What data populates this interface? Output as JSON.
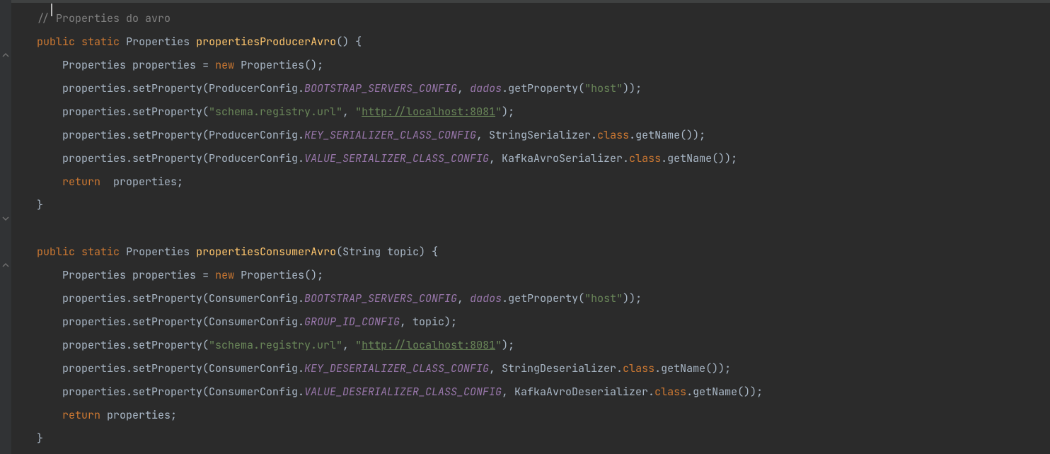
{
  "code": {
    "comment": "// Properties do avro",
    "method1": {
      "modifiers": [
        "public",
        "static"
      ],
      "returnType": "Properties",
      "name": "propertiesProducerAvro",
      "params": "()",
      "body": {
        "decl_type": "Properties",
        "decl_var": "properties",
        "equals": "=",
        "new_kw": "new",
        "ctor": "Properties()",
        "line1_pre": "properties.setProperty(ProducerConfig.",
        "line1_const": "BOOTSTRAP_SERVERS_CONFIG",
        "line1_comma": ", ",
        "line1_dados": "dados",
        "line1_tail": ".getProperty(",
        "line1_str": "\"host\"",
        "line1_close": "));",
        "line2_pre": "properties.setProperty(",
        "line2_str1": "\"schema.registry.url\"",
        "line2_comma": ", ",
        "line2_q1": "\"",
        "line2_url": "http://localhost:8081",
        "line2_q2": "\"",
        "line2_close": ");",
        "line3_pre": "properties.setProperty(ProducerConfig.",
        "line3_const": "KEY_SERIALIZER_CLASS_CONFIG",
        "line3_mid": ", StringSerializer.",
        "line3_class": "class",
        "line3_tail": ".getName());",
        "line4_pre": "properties.setProperty(ProducerConfig.",
        "line4_const": "VALUE_SERIALIZER_CLASS_CONFIG",
        "line4_mid": ", KafkaAvroSerializer.",
        "line4_class": "class",
        "line4_tail": ".getName());",
        "return_kw": "return",
        "return_val": "  properties;"
      }
    },
    "method2": {
      "modifiers": [
        "public",
        "static"
      ],
      "returnType": "Properties",
      "name": "propertiesConsumerAvro",
      "params": "(String topic)",
      "body": {
        "decl_type": "Properties",
        "decl_var": "properties",
        "equals": "=",
        "new_kw": "new",
        "ctor": "Properties()",
        "line1_pre": "properties.setProperty(ConsumerConfig.",
        "line1_const": "BOOTSTRAP_SERVERS_CONFIG",
        "line1_comma": ", ",
        "line1_dados": "dados",
        "line1_tail": ".getProperty(",
        "line1_str": "\"host\"",
        "line1_close": "));",
        "line2_pre": "properties.setProperty(ConsumerConfig.",
        "line2_const": "GROUP_ID_CONFIG",
        "line2_tail": ", topic);",
        "line3_pre": "properties.setProperty(",
        "line3_str1": "\"schema.registry.url\"",
        "line3_comma": ", ",
        "line3_q1": "\"",
        "line3_url": "http://localhost:8081",
        "line3_q2": "\"",
        "line3_close": ");",
        "line4_pre": "properties.setProperty(ConsumerConfig.",
        "line4_const": "KEY_DESERIALIZER_CLASS_CONFIG",
        "line4_mid": ", StringDeserializer.",
        "line4_class": "class",
        "line4_tail": ".getName());",
        "line5_pre": "properties.setProperty(ConsumerConfig.",
        "line5_const": "VALUE_DESERIALIZER_CLASS_CONFIG",
        "line5_mid": ", KafkaAvroDeserializer.",
        "line5_class": "class",
        "line5_tail": ".getName());",
        "return_kw": "return",
        "return_val": " properties;"
      }
    },
    "braces": {
      "open": " {",
      "close": "}",
      "semi": ";"
    }
  }
}
